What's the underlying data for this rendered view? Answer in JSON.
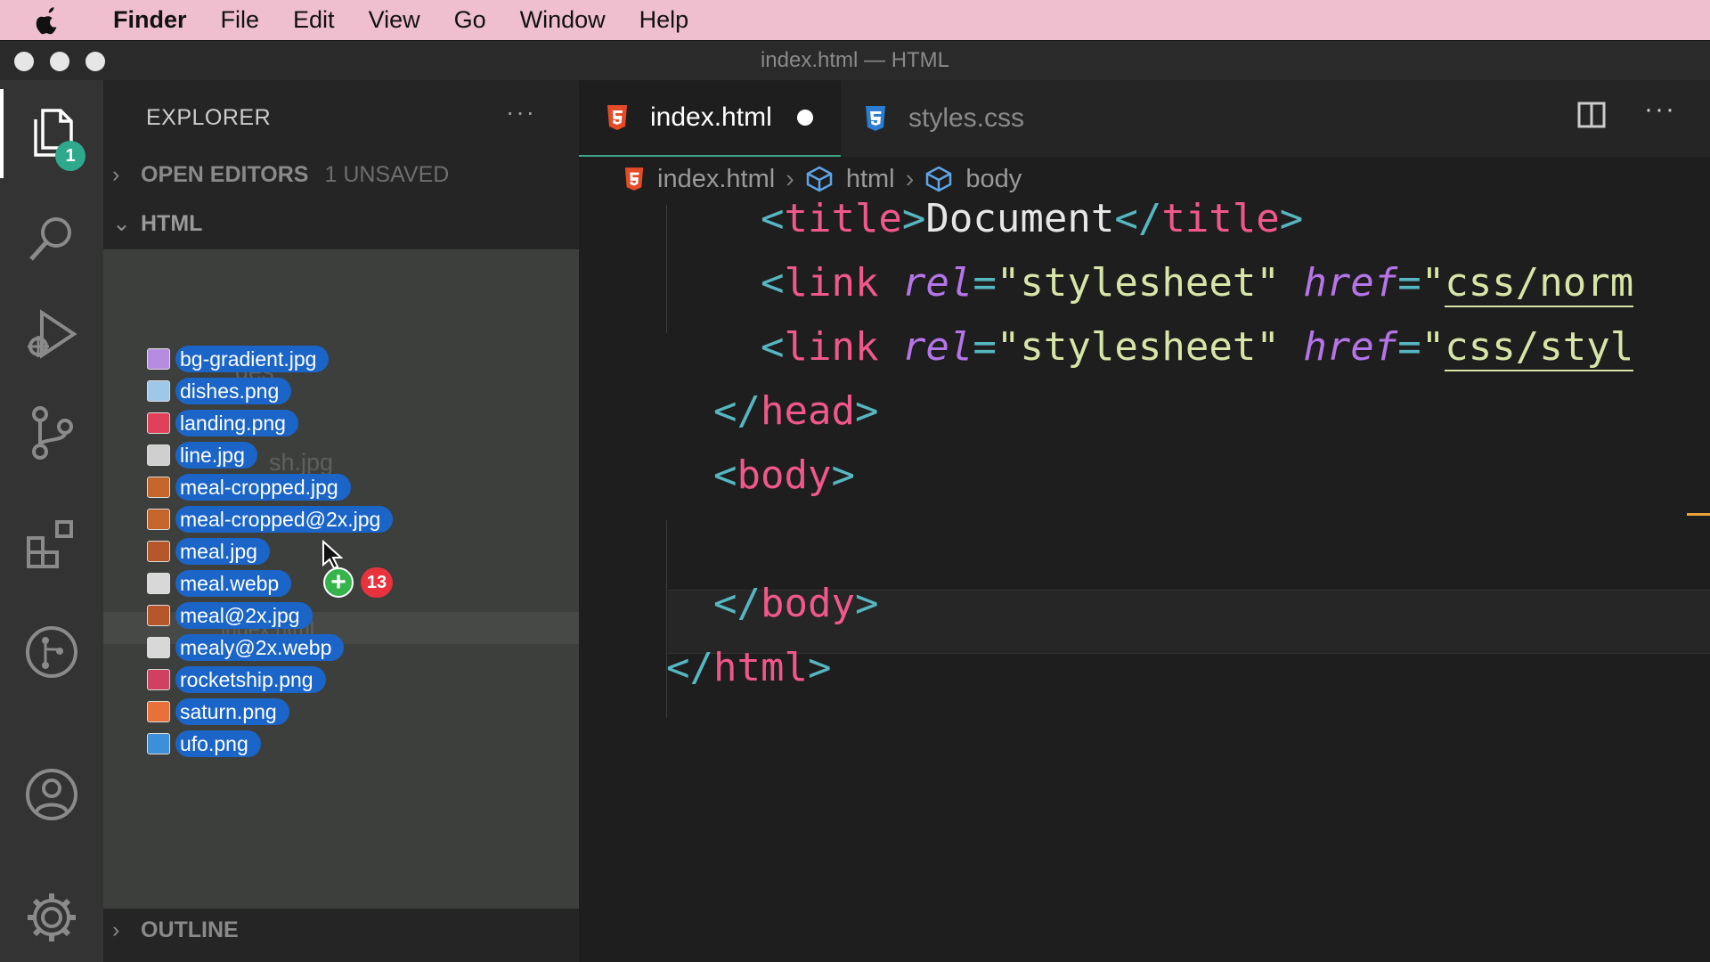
{
  "menubar": {
    "app": "Finder",
    "items": [
      "File",
      "Edit",
      "View",
      "Go",
      "Window",
      "Help"
    ]
  },
  "window": {
    "title": "index.html — HTML"
  },
  "activity": {
    "explorer_badge": "1"
  },
  "sidebar": {
    "title": "EXPLORER",
    "more": "···",
    "open_editors": {
      "label": "OPEN EDITORS",
      "sub": "1 UNSAVED"
    },
    "folder": "HTML",
    "outline": "OUTLINE",
    "ghost_texts": [
      "ges",
      "sh.jpg",
      "index.html"
    ]
  },
  "drag": {
    "files": [
      {
        "name": "bg-gradient.jpg",
        "color": "#b58ce0"
      },
      {
        "name": "dishes.png",
        "color": "#9ec7e8"
      },
      {
        "name": "landing.png",
        "color": "#e0405a"
      },
      {
        "name": "line.jpg",
        "color": "#cfcfcf"
      },
      {
        "name": "meal-cropped.jpg",
        "color": "#c4662c"
      },
      {
        "name": "meal-cropped@2x.jpg",
        "color": "#c4662c"
      },
      {
        "name": "meal.jpg",
        "color": "#b5572a"
      },
      {
        "name": "meal.webp",
        "color": "#d8d8d8"
      },
      {
        "name": "meal@2x.jpg",
        "color": "#b5572a"
      },
      {
        "name": "mealy@2x.webp",
        "color": "#d8d8d8"
      },
      {
        "name": "rocketship.png",
        "color": "#d04060"
      },
      {
        "name": "saturn.png",
        "color": "#e8713a"
      },
      {
        "name": "ufo.png",
        "color": "#3c8fd8"
      }
    ],
    "plus": "+",
    "count": "13"
  },
  "editor": {
    "tabs": [
      {
        "label": "index.html",
        "modified": true
      },
      {
        "label": "styles.css"
      }
    ],
    "breadcrumb": [
      "index.html",
      "html",
      "body"
    ],
    "code_lines": [
      {
        "indent": "    ",
        "tokens": [
          [
            "p",
            "<"
          ],
          [
            "t",
            "title"
          ],
          [
            "p",
            ">"
          ],
          [
            "x",
            "Document"
          ],
          [
            "p",
            "</"
          ],
          [
            "t",
            "title"
          ],
          [
            "p",
            ">"
          ]
        ]
      },
      {
        "indent": "    ",
        "tokens": [
          [
            "p",
            "<"
          ],
          [
            "t",
            "link"
          ],
          [
            "x",
            " "
          ],
          [
            "a",
            "rel"
          ],
          [
            "p",
            "="
          ],
          [
            "s",
            "\"stylesheet\""
          ],
          [
            "x",
            " "
          ],
          [
            "a",
            "href"
          ],
          [
            "p",
            "="
          ],
          [
            "s",
            "\""
          ],
          [
            "u",
            "css/norm"
          ]
        ]
      },
      {
        "indent": "    ",
        "tokens": [
          [
            "p",
            "<"
          ],
          [
            "t",
            "link"
          ],
          [
            "x",
            " "
          ],
          [
            "a",
            "rel"
          ],
          [
            "p",
            "="
          ],
          [
            "s",
            "\"stylesheet\""
          ],
          [
            "x",
            " "
          ],
          [
            "a",
            "href"
          ],
          [
            "p",
            "="
          ],
          [
            "s",
            "\""
          ],
          [
            "u",
            "css/styl"
          ]
        ]
      },
      {
        "indent": "  ",
        "tokens": [
          [
            "p",
            "</"
          ],
          [
            "t",
            "head"
          ],
          [
            "p",
            ">"
          ]
        ]
      },
      {
        "indent": "  ",
        "tokens": [
          [
            "p",
            "<"
          ],
          [
            "t",
            "body"
          ],
          [
            "p",
            ">"
          ]
        ]
      },
      {
        "indent": "",
        "tokens": []
      },
      {
        "indent": "  ",
        "tokens": [
          [
            "p",
            "</"
          ],
          [
            "t",
            "body"
          ],
          [
            "p",
            ">"
          ]
        ]
      },
      {
        "indent": "",
        "tokens": [
          [
            "p",
            "</"
          ],
          [
            "t",
            "html"
          ],
          [
            "p",
            ">"
          ]
        ]
      }
    ]
  }
}
